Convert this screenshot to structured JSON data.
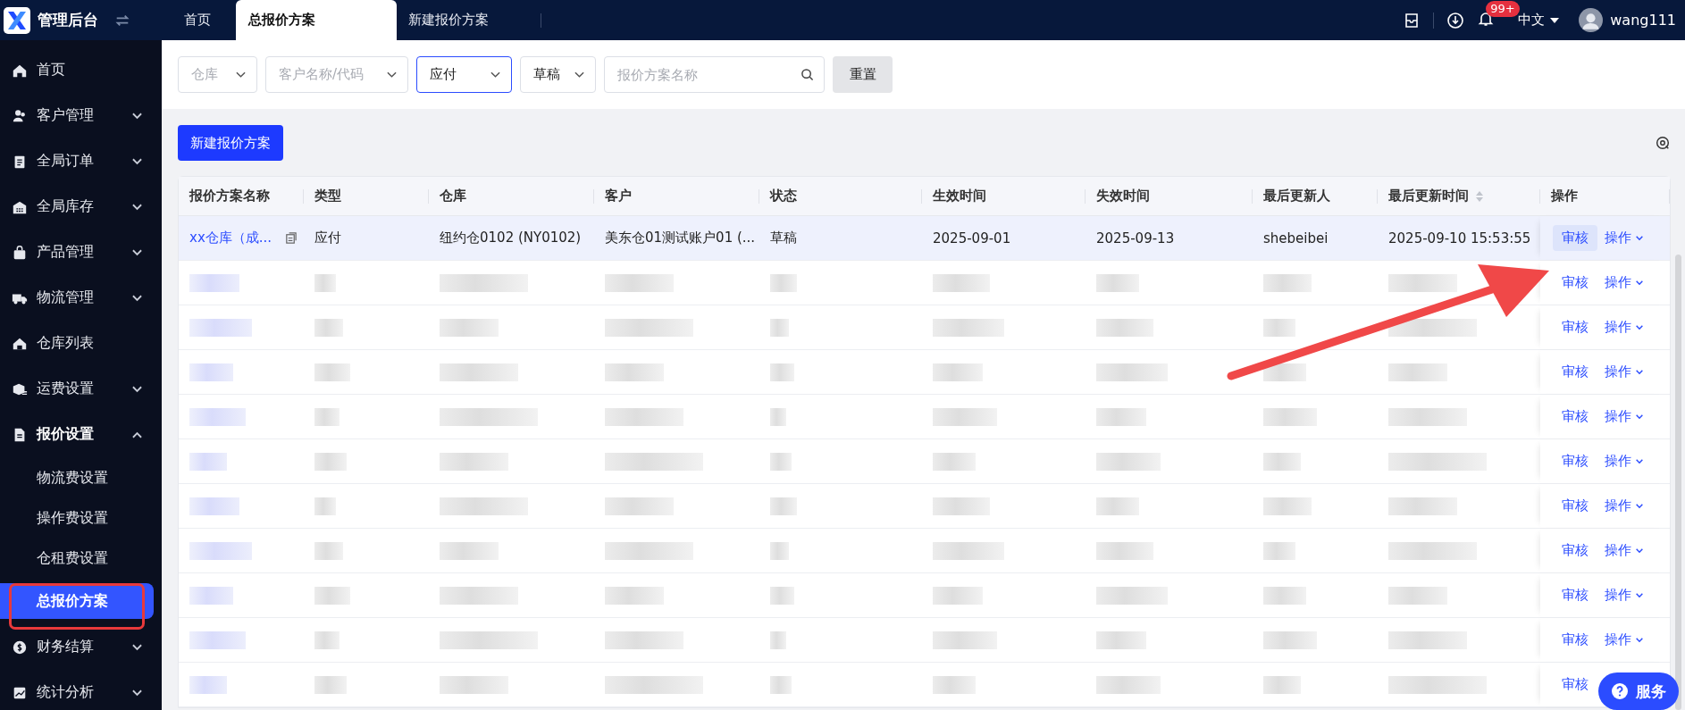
{
  "app": {
    "title": "管理后台"
  },
  "tabs": [
    {
      "label": "首页",
      "selected": false
    },
    {
      "label": "总报价方案",
      "selected": true
    },
    {
      "label": "新建报价方案",
      "selected": false
    }
  ],
  "header": {
    "badge": "99+",
    "language": "中文",
    "user": "wang111"
  },
  "sidebar": {
    "items": [
      {
        "label": "首页",
        "selected": false
      },
      {
        "label": "客户管理",
        "selected": false,
        "expanded": false
      },
      {
        "label": "全局订单",
        "selected": false,
        "expanded": false
      },
      {
        "label": "全局库存",
        "selected": false,
        "expanded": false
      },
      {
        "label": "产品管理",
        "selected": false,
        "expanded": false
      },
      {
        "label": "物流管理",
        "selected": false,
        "expanded": false
      },
      {
        "label": "仓库列表",
        "selected": false
      },
      {
        "label": "运费设置",
        "selected": false,
        "expanded": false
      },
      {
        "label": "报价设置",
        "selected": false,
        "expanded": true,
        "children": [
          {
            "label": "物流费设置",
            "selected": false,
            "annotated": false
          },
          {
            "label": "操作费设置",
            "selected": false,
            "annotated": false
          },
          {
            "label": "仓租费设置",
            "selected": false,
            "annotated": false
          },
          {
            "label": "总报价方案",
            "selected": true,
            "annotated": true
          }
        ]
      },
      {
        "label": "财务结算",
        "selected": false,
        "expanded": false
      },
      {
        "label": "统计分析",
        "selected": false,
        "expanded": false
      }
    ]
  },
  "filters": [
    {
      "kind": "select",
      "placeholder": "仓库",
      "focused": false
    },
    {
      "kind": "select",
      "placeholder": "客户名称/代码",
      "focused": false
    },
    {
      "kind": "select",
      "value": "应付",
      "focused": true
    },
    {
      "kind": "select",
      "value": "草稿",
      "focused": false
    },
    {
      "kind": "search",
      "placeholder": "报价方案名称",
      "focused": false
    }
  ],
  "reset_button": "重置",
  "create_button": "新建报价方案",
  "table": {
    "columns": [
      {
        "label": "报价方案名称"
      },
      {
        "label": "类型"
      },
      {
        "label": "仓库"
      },
      {
        "label": "客户"
      },
      {
        "label": "状态"
      },
      {
        "label": "生效时间"
      },
      {
        "label": "失效时间"
      },
      {
        "label": "最后更新人"
      },
      {
        "label": "最后更新时间",
        "sortable": true
      },
      {
        "label": "操作"
      }
    ],
    "rows": [
      {
        "blurred": false,
        "selected": true,
        "cells": [
          "xx仓库（成...",
          "应付",
          "纽约仓0102 (NY0102)",
          "美东仓01测试账户01 (...",
          "草稿",
          "2025-09-01",
          "2025-09-13",
          "shebeibei",
          "2025-09-10 15:53:55"
        ],
        "review": "审核",
        "more": "操作"
      },
      {
        "blurred": true,
        "selected": false,
        "review": "审核",
        "more": "操作"
      },
      {
        "blurred": true,
        "selected": false,
        "review": "审核",
        "more": "操作"
      },
      {
        "blurred": true,
        "selected": false,
        "review": "审核",
        "more": "操作"
      },
      {
        "blurred": true,
        "selected": false,
        "review": "审核",
        "more": "操作"
      },
      {
        "blurred": true,
        "selected": false,
        "review": "审核",
        "more": "操作"
      },
      {
        "blurred": true,
        "selected": false,
        "review": "审核",
        "more": "操作"
      },
      {
        "blurred": true,
        "selected": false,
        "review": "审核",
        "more": "操作"
      },
      {
        "blurred": true,
        "selected": false,
        "review": "审核",
        "more": "操作"
      },
      {
        "blurred": true,
        "selected": false,
        "review": "审核",
        "more": "操作"
      },
      {
        "blurred": true,
        "selected": false,
        "review": "审核"
      }
    ]
  },
  "help_button": "服务"
}
